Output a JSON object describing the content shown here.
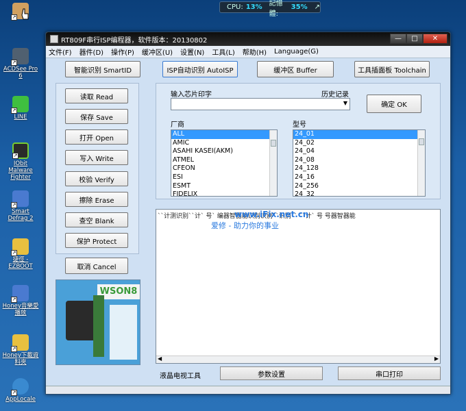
{
  "desktop": {
    "icons": [
      {
        "label": "",
        "color": "#d0a060"
      },
      {
        "label": "ACDSee Pro 6",
        "color": "#506070"
      },
      {
        "label": "LINE",
        "color": "#3fbf3f"
      },
      {
        "label": "IObit Malware Fighter",
        "color": "#2a2a2a"
      },
      {
        "label": "Smart Defrag 2",
        "color": "#4a7ad0"
      },
      {
        "label": "捷徑 - EZBOOT",
        "color": "#e8c040"
      },
      {
        "label": "Honey音樂愛播放",
        "color": "#4a7ad0"
      },
      {
        "label": "Honey下載資料夾",
        "color": "#e8c040"
      },
      {
        "label": "AppLocale",
        "color": "#3a8ad0"
      }
    ]
  },
  "cpu_meter": {
    "cpu_label": "CPU:",
    "cpu_value": "13%",
    "mem_label": "記憶體:",
    "mem_value": "35%",
    "arrow": "↗"
  },
  "window": {
    "title": "RT809F串行ISP编程器，软件版本：20130802",
    "controls": {
      "minimize": "—",
      "maximize": "□",
      "close": "✕"
    },
    "menu": [
      "文件(F)",
      "器件(D)",
      "操作(P)",
      "缓冲区(U)",
      "设置(N)",
      "工具(L)",
      "帮助(H)",
      "Language(G)"
    ],
    "top_buttons": {
      "smartid": "智能识别 SmartID",
      "autoisp": "ISP自动识别 AutoISP",
      "buffer": "缓冲区 Buffer",
      "toolchain": "工具插面板 Toolchain"
    },
    "ops": [
      "读取 Read",
      "保存 Save",
      "打开 Open",
      "写入 Write",
      "校验 Verify",
      "擦除 Erase",
      "查空 Blank",
      "保护 Protect"
    ],
    "cancel": "取消 Cancel",
    "chip_image_label": "WSON8",
    "search": {
      "label": "输入芯片印字",
      "history_label": "历史记录",
      "value": "",
      "ok_button": "确定 OK"
    },
    "vendor": {
      "label": "厂商",
      "items": [
        "ALL",
        "AMIC",
        "ASAHI KASEI(AKM)",
        "ATMEL",
        "CFEON",
        "ESI",
        "ESMT",
        "FIDELIX"
      ]
    },
    "model": {
      "label": "型号",
      "items": [
        "24_01",
        "24_02",
        "24_04",
        "24_08",
        "24_128",
        "24_16",
        "24_256",
        "24_32"
      ]
    },
    "log": {
      "text": "``计测识别``计`  号` 编器智器能识别识别``识别`` ``计`  号  号器智器能",
      "watermark_url": "www.iFix.net.cn",
      "watermark_slogan": "爱修 - 助力你的事业"
    },
    "bottom_tabs": [
      "液晶电视工具",
      "参数设置",
      "串口打印"
    ]
  }
}
